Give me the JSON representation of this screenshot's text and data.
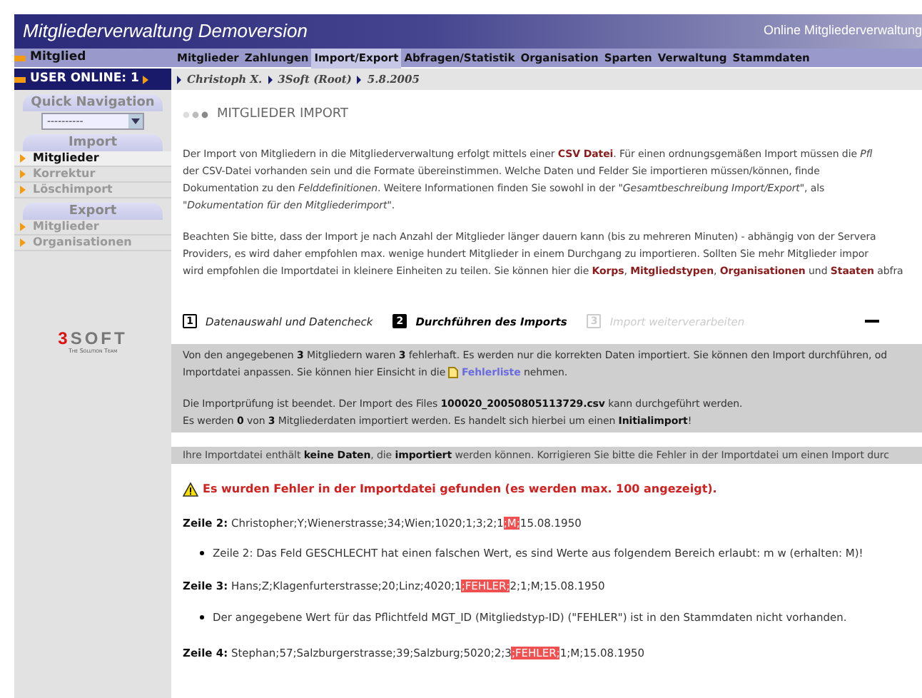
{
  "header": {
    "title": "Mitgliederverwaltung Demoversion",
    "subtitle": "Online Mitgliederverwaltung"
  },
  "sidebar": {
    "section_title": "Mitglied",
    "user_online": "USER ONLINE: 1",
    "quick_nav": {
      "title": "Quick Navigation",
      "value": "----------"
    },
    "groups": [
      {
        "title": "Import",
        "items": [
          {
            "label": "Mitglieder",
            "selected": true
          },
          {
            "label": "Korrektur",
            "selected": false
          },
          {
            "label": "Löschimport",
            "selected": false
          }
        ]
      },
      {
        "title": "Export",
        "items": [
          {
            "label": "Mitglieder",
            "selected": false
          },
          {
            "label": "Organisationen",
            "selected": false
          }
        ]
      }
    ],
    "logo": {
      "text": "3SOFT",
      "tagline": "The Solution Team"
    }
  },
  "menu": [
    {
      "label": "Mitglieder",
      "selected": false
    },
    {
      "label": "Zahlungen",
      "selected": false
    },
    {
      "label": "Import/Export",
      "selected": true
    },
    {
      "label": "Abfragen/Statistik",
      "selected": false
    },
    {
      "label": "Organisation",
      "selected": false
    },
    {
      "label": "Sparten",
      "selected": false
    },
    {
      "label": "Verwaltung",
      "selected": false
    },
    {
      "label": "Stammdaten",
      "selected": false
    }
  ],
  "breadcrumb": [
    "Christoph X.",
    "3Soft (Root)",
    "5.8.2005"
  ],
  "page_title": "MITGLIEDER IMPORT",
  "intro_lines": [
    "Der Import von Mitgliedern in die Mitgliederverwaltung erfolgt mittels einer **CSV Datei**. Für einen ordnungsgemäßen Import müssen die *Pfl*",
    "der CSV-Datei vorhanden sein und die Formate übereinstimmen. Welche Daten und Felder Sie importieren müssen/können, finde",
    "Dokumentation zu den *Felddefinitionen*. Weitere Informationen finden Sie sowohl in der *\"Gesamtbeschreibung Import/Export\"*, als",
    "*\"Dokumentation für den Mitgliederimport\"*."
  ],
  "note_lines": [
    "Beachten Sie bitte, dass der Import je nach Anzahl der Mitglieder länger dauern kann (bis zu mehreren Minuten) - abhängig von der Servera",
    "Providers, es wird daher empfohlen max. wenige hundert Mitglieder in einem Durchgang zu importieren. Sollten Sie mehr Mitglieder impor",
    "wird empfohlen die Importdatei in kleinere Einheiten zu teilen. Sie können hier die **Korps**, **Mitgliedstypen**, **Organisationen** und **Staaten** abfra"
  ],
  "steps": [
    {
      "number": "1",
      "label": "Datenauswahl und Datencheck",
      "selected": false,
      "disabled": false
    },
    {
      "number": "2",
      "label": "Durchführen des Imports",
      "selected": true,
      "disabled": false
    },
    {
      "number": "3",
      "label": "Import weiterverarbeiten",
      "selected": false,
      "disabled": true
    }
  ],
  "result_box": {
    "line_1": "Von den angegebenen **3** Mitgliedern waren **3** fehlerhaft. Es werden nur die korrekten Daten importiert. Sie können den Import durchführen, od",
    "line_2_before": "Importdatei anpassen. Sie können hier Einsicht in die",
    "link": "Fehlerliste",
    "line_2_after": "nehmen.",
    "line_3": "Die Importprüfung ist beendet. Der Import des Files **100020_20050805113729.csv** kann durchgeführt werden.",
    "line_4": "Es werden **0** von **3** Mitgliederdaten importiert werden. Es handelt sich hierbei um einen **Initialimport**!"
  },
  "no_data_notice": "Ihre Importdatei enthält **keine Daten**, die **importiert** werden können. Korrigieren Sie bitte die Fehler in der Importdatei um einen Import durc",
  "warning": "Es wurden Fehler in der Importdatei gefunden (es werden max. 100 angezeigt).",
  "error_rows": [
    {
      "label": "Zeile 2:",
      "data_before": "Christopher;Y;Wienerstrasse;34;Wien;1020;1;3;2;1",
      "data_error": ";M;",
      "data_after": "15.08.1950",
      "messages": [
        "Zeile 2: Das Feld GESCHLECHT hat einen falschen Wert, es sind Werte aus folgendem Bereich erlaubt: m w (erhalten: M)!"
      ]
    },
    {
      "label": "Zeile 3:",
      "data_before": "Hans;Z;Klagenfurterstrasse;20;Linz;4020;1",
      "data_error": ";FEHLER;",
      "data_after": "2;1;M;15.08.1950",
      "messages": [
        "Der angegebene Wert für das Pflichtfeld MGT_ID (Mitgliedstyp-ID) (\"FEHLER\") ist in den Stammdaten nicht vorhanden."
      ]
    },
    {
      "label": "Zeile 4:",
      "data_before": "Stephan;57;Salzburgerstrasse;39;Salzburg;5020;2;3",
      "data_error": ";FEHLER;",
      "data_after": "1;M;15.08.1950",
      "messages": []
    }
  ]
}
